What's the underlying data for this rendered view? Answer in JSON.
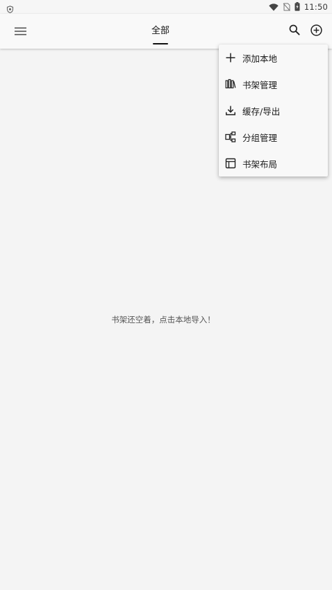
{
  "status_bar": {
    "time": "11:50",
    "icons": [
      "shield-icon",
      "wifi-icon",
      "no-sim-icon",
      "battery-charging-icon"
    ]
  },
  "toolbar": {
    "menu_icon": "hamburger-menu-icon",
    "tab_label": "全部",
    "search_icon": "search-icon",
    "add_icon": "add-circle-icon"
  },
  "empty_state": {
    "message": "书架还空着，点击本地导入！"
  },
  "popup_menu": {
    "items": [
      {
        "label": "添加本地",
        "icon": "plus-icon"
      },
      {
        "label": "书架管理",
        "icon": "bookshelf-icon"
      },
      {
        "label": "缓存/导出",
        "icon": "download-icon"
      },
      {
        "label": "分组管理",
        "icon": "group-icon"
      },
      {
        "label": "书架布局",
        "icon": "layout-icon"
      }
    ]
  },
  "colors": {
    "background": "#f4f4f4",
    "toolbar": "#f9f9f9",
    "menu": "#f8f8f8",
    "text": "#212121"
  }
}
